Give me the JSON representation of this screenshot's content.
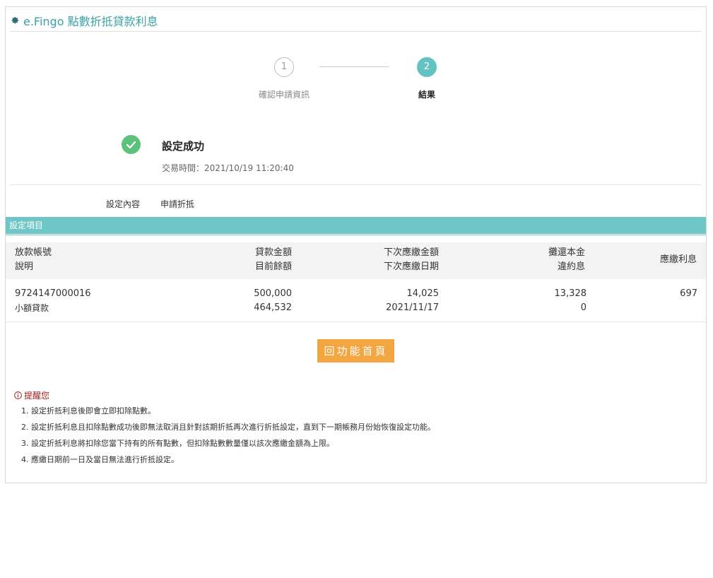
{
  "header": {
    "title": "e.Fingo 點數折抵貸款利息"
  },
  "steps": [
    {
      "number": "1",
      "label": "確認申請資訊"
    },
    {
      "number": "2",
      "label": "結果"
    }
  ],
  "result": {
    "title": "設定成功",
    "time": "交易時間：2021/10/19 11:20:40"
  },
  "setting": {
    "label": "設定內容",
    "value": "申請折抵"
  },
  "section_title": "設定項目",
  "table": {
    "headers": {
      "account": "放款帳號",
      "desc": "說明",
      "loan_amount": "貸款金額",
      "balance": "目前餘額",
      "next_amount": "下次應繳金額",
      "next_date": "下次應繳日期",
      "principal": "攤還本金",
      "penalty": "違約息",
      "interest": "應繳利息"
    },
    "rows": [
      {
        "account": "9724147000016",
        "desc": "小額貸款",
        "loan_amount": "500,000",
        "balance": "464,532",
        "next_amount": "14,025",
        "next_date": "2021/11/17",
        "principal": "13,328",
        "penalty": "0",
        "interest": "697"
      }
    ]
  },
  "home_button": "回功能首頁",
  "reminder": {
    "title": "提醒您",
    "notes": [
      "1. 設定折抵利息後即會立即扣除點數。",
      "2. 設定折抵利息且扣除點數成功後即無法取消且針對該期折抵再次進行折抵設定，直到下一期帳務月份始恢復設定功能。",
      "3. 設定折抵利息將扣除您當下持有的所有點數，但扣除點數數量僅以該次應繳金額為上限。",
      "4. 應繳日期前一日及當日無法進行折抵設定。"
    ]
  },
  "colors": {
    "teal": "#6ec7c6",
    "accent": "#3aa3a7",
    "success": "#5cc17b",
    "button": "#f3a640",
    "warning": "#9b1c1c"
  }
}
